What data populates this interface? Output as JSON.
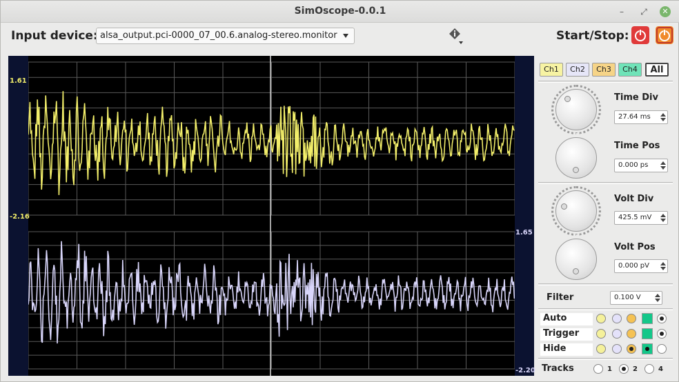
{
  "window": {
    "title": "SimOscope-0.0.1"
  },
  "toolbar": {
    "input_label": "Input device:",
    "device": "alsa_output.pci-0000_07_00.6.analog-stereo.monitor",
    "start_stop_label": "Start/Stop:"
  },
  "scope": {
    "ch1_top": "1.61",
    "ch1_bottom": "-2.16",
    "ch2_top": "1.65",
    "ch2_bottom": "-2.20",
    "ch1_color": "#f2ee6a",
    "ch2_color": "#d9d6fb"
  },
  "channels": {
    "ch1": "Ch1",
    "ch2": "Ch2",
    "ch3": "Ch3",
    "ch4": "Ch4",
    "all": "All",
    "colors": [
      "#f7f3a3",
      "#e6e6f8",
      "#f6d487",
      "#6fe3b8"
    ]
  },
  "controls": {
    "time_div_label": "Time Div",
    "time_div_value": "27.64 ms",
    "time_pos_label": "Time Pos",
    "time_pos_value": "0.000 ps",
    "volt_div_label": "Volt Div",
    "volt_div_value": "425.5 mV",
    "volt_pos_label": "Volt Pos",
    "volt_pos_value": "0.000 pV",
    "filter_label": "Filter",
    "filter_value": "0.100 V"
  },
  "modes": {
    "auto": "Auto",
    "trigger": "Trigger",
    "hide": "Hide"
  },
  "tracks": {
    "label": "Tracks",
    "options": [
      "1",
      "2",
      "4"
    ],
    "selected": "2"
  }
}
